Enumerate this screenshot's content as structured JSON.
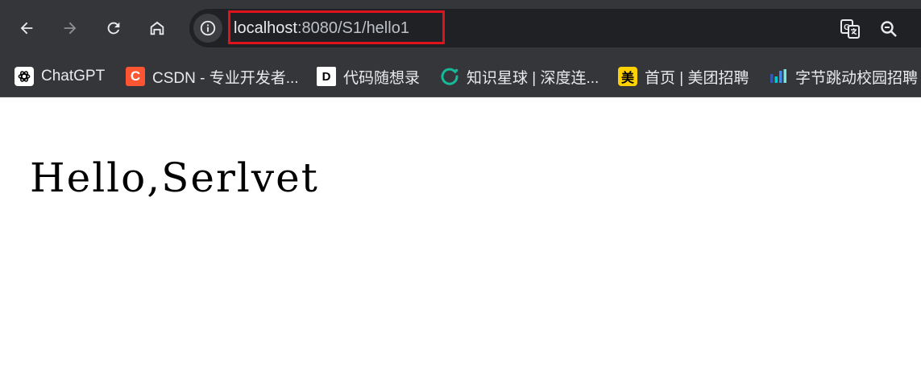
{
  "browser": {
    "url_host": "localhost",
    "url_path": ":8080/S1/hello1",
    "highlight_color": "#e0121e"
  },
  "toolbar": {
    "icons": [
      "back-arrow-icon",
      "forward-arrow-icon",
      "reload-icon",
      "home-icon",
      "info-icon",
      "translate-icon",
      "zoom-icon"
    ]
  },
  "bookmarks": [
    {
      "label": "ChatGPT",
      "icon": "chatgpt-icon",
      "fav_text": "",
      "fav_bg": "#ffffff",
      "fav_color": "#000000"
    },
    {
      "label": "CSDN - 专业开发者...",
      "icon": "csdn-icon",
      "fav_text": "C",
      "fav_bg": "#fc5531",
      "fav_color": "#ffffff"
    },
    {
      "label": "代码随想录",
      "icon": "daima-icon",
      "fav_text": "D",
      "fav_bg": "#ffffff",
      "fav_color": "#000000"
    },
    {
      "label": "知识星球 | 深度连...",
      "icon": "zsxq-icon",
      "fav_text": "",
      "fav_bg": "transparent",
      "fav_color": "#16b998"
    },
    {
      "label": "首页 | 美团招聘",
      "icon": "meituan-icon",
      "fav_text": "美",
      "fav_bg": "#ffd100",
      "fav_color": "#000000"
    },
    {
      "label": "字节跳动校园招聘",
      "icon": "bytedance-icon",
      "fav_text": "",
      "fav_bg": "transparent",
      "fav_color": "#3c8cff"
    }
  ],
  "page": {
    "heading": "Hello,Serlvet"
  }
}
